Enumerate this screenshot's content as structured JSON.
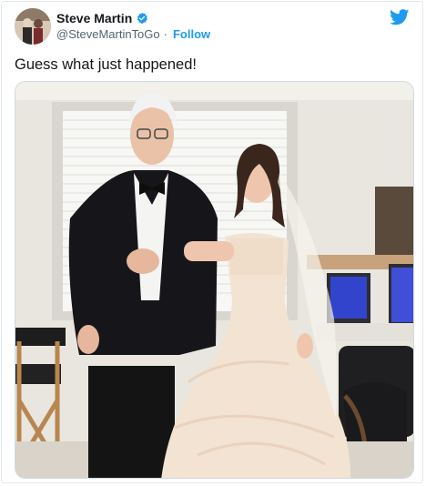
{
  "tweet": {
    "author": {
      "display_name": "Steve Martin",
      "handle": "@SteveMartinToGo",
      "verified": true,
      "follow_label": "Follow"
    },
    "text": "Guess what just happened!",
    "brand_color": "#1d9bf0",
    "logo_icon": "twitter-bird-icon",
    "verified_icon": "verified-badge-icon"
  }
}
